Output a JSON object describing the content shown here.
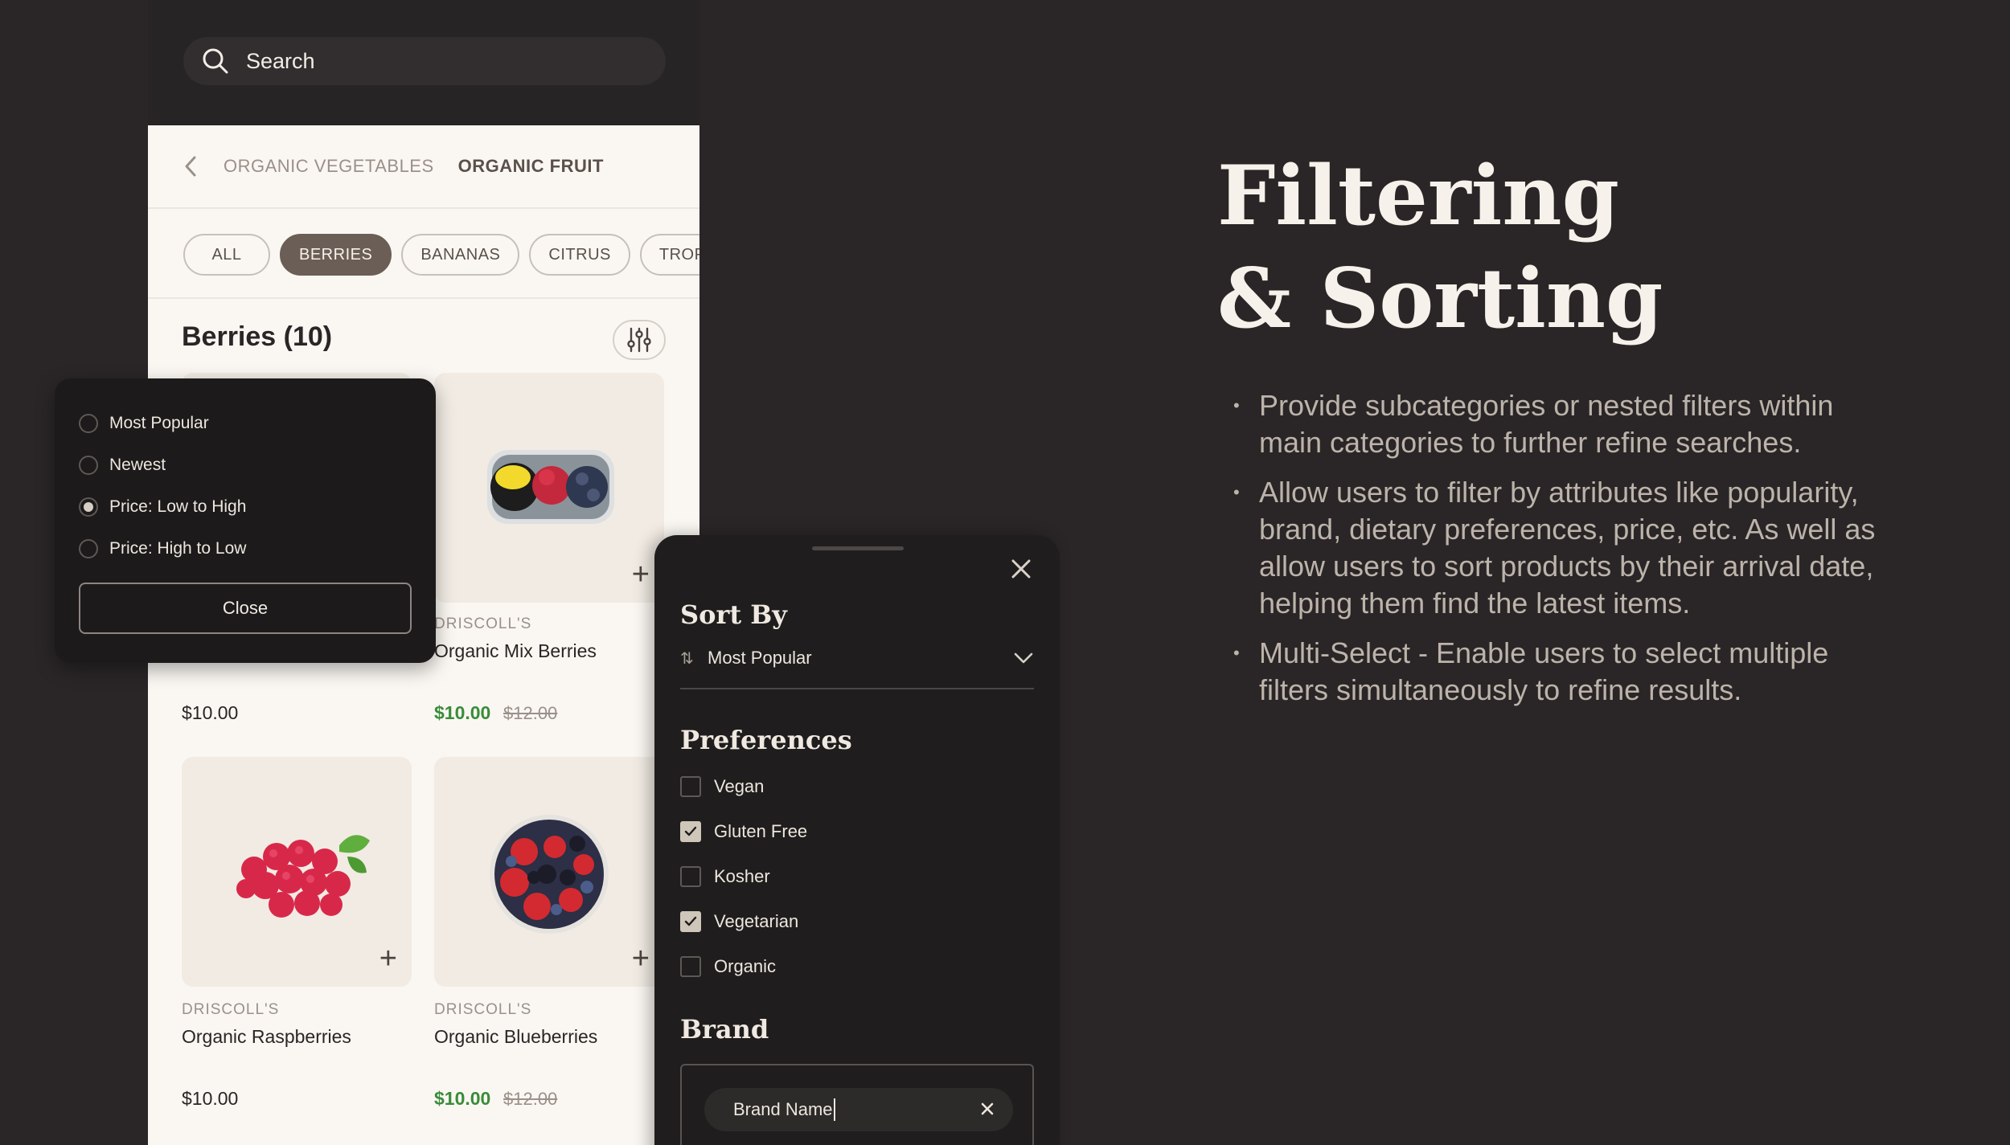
{
  "search": {
    "placeholder": "Search",
    "icon": "search-icon"
  },
  "breadcrumb": {
    "back_icon": "chevron-left-icon",
    "items": [
      {
        "label": "ORGANIC VEGETABLES",
        "active": false
      },
      {
        "label": "ORGANIC FRUIT",
        "active": true
      }
    ]
  },
  "chips": [
    {
      "label": "ALL",
      "active": false
    },
    {
      "label": "BERRIES",
      "active": true
    },
    {
      "label": "BANANAS",
      "active": false
    },
    {
      "label": "CITRUS",
      "active": false
    },
    {
      "label": "TROPICAL",
      "active": false
    }
  ],
  "section": {
    "title": "Berries (10)",
    "filter_icon": "sliders-icon"
  },
  "products": [
    {
      "brand": "",
      "name": "",
      "price": "$10.00",
      "old_price": ""
    },
    {
      "brand": "DRISCOLL'S",
      "name": "Organic Mix Berries",
      "price": "$10.00",
      "old_price": "$12.00"
    },
    {
      "brand": "DRISCOLL'S",
      "name": "Organic Raspberries",
      "price": "$10.00",
      "old_price": ""
    },
    {
      "brand": "DRISCOLL'S",
      "name": "Organic Blueberries",
      "price": "$10.00",
      "old_price": "$12.00"
    }
  ],
  "sort_popup": {
    "options": [
      {
        "label": "Most Popular",
        "selected": false
      },
      {
        "label": "Newest",
        "selected": false
      },
      {
        "label": "Price: Low to High",
        "selected": true
      },
      {
        "label": "Price: High to Low",
        "selected": false
      }
    ],
    "close_label": "Close"
  },
  "filter_sheet": {
    "sort_heading": "Sort By",
    "sort_value": "Most Popular",
    "sort_icon": "sort-arrows-icon",
    "preferences_heading": "Preferences",
    "preferences": [
      {
        "label": "Vegan",
        "checked": false
      },
      {
        "label": "Gluten Free",
        "checked": true
      },
      {
        "label": "Kosher",
        "checked": false
      },
      {
        "label": "Vegetarian",
        "checked": true
      },
      {
        "label": "Organic",
        "checked": false
      }
    ],
    "brand_heading": "Brand",
    "brand_value": "Brand Name"
  },
  "hero": {
    "title_line1": "Filtering",
    "title_line2": "& Sorting",
    "bullets": [
      "Provide subcategories or nested filters within main categories to further refine searches.",
      "Allow users to filter by attributes like popularity, brand, dietary preferences, price, etc. As well as allow users to sort products by their arrival date, helping them find the latest items.",
      "Multi-Select - Enable users to select multiple filters simultaneously to refine results."
    ]
  },
  "colors": {
    "background": "#2a2627",
    "panel": "#faf7f2",
    "active_chip": "#6b5e57",
    "sale_price": "#3a8c3a"
  }
}
